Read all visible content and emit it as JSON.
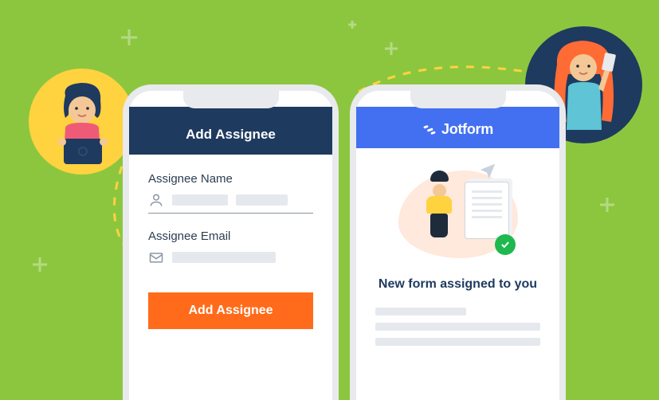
{
  "leftPhone": {
    "header": "Add Assignee",
    "nameLabel": "Assignee Name",
    "emailLabel": "Assignee Email",
    "button": "Add Assignee"
  },
  "rightPhone": {
    "brand": "Jotform",
    "title": "New form assigned to you"
  }
}
